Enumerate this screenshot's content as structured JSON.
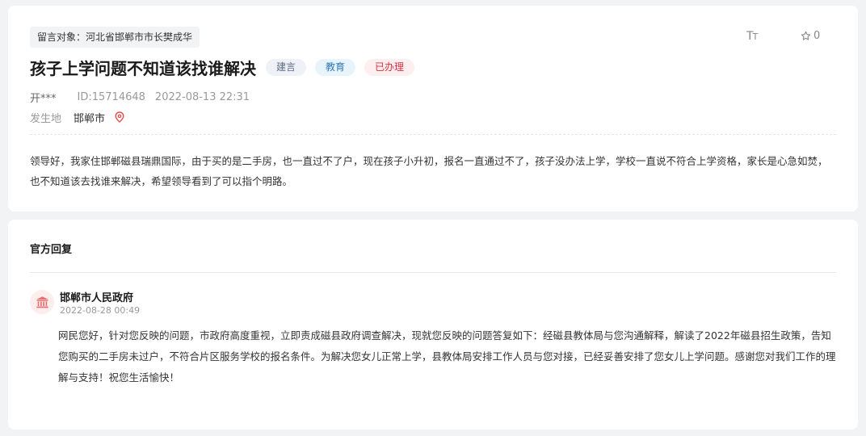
{
  "message": {
    "target": "留言对象：河北省邯郸市市长樊成华",
    "title": "孩子上学问题不知道该找谁解决",
    "tags": [
      "建言",
      "教育",
      "已办理"
    ],
    "user": "开***",
    "id": "ID:15714648",
    "datetime": "2022-08-13 22:31",
    "location_label": "发生地",
    "location": "邯郸市",
    "content": "领导好，我家住邯郸磁县瑞鼎国际，由于买的是二手房，也一直过不了户，现在孩子小升初，报名一直通过不了，孩子没办法上学，学校一直说不符合上学资格，家长是心急如焚，也不知道该去找谁来解决，希望领导看到了可以指个明路。"
  },
  "toolbar": {
    "font_icon": "font-size-icon",
    "star_icon": "star-outline-icon",
    "star_count": "0"
  },
  "reply": {
    "heading": "官方回复",
    "avatar_icon": "government-building-icon",
    "org": "邯郸市人民政府",
    "datetime": "2022-08-28 00:49",
    "content": "网民您好，针对您反映的问题，市政府高度重视，立即责成磁县政府调查解决，现就您反映的问题答复如下：经磁县教体局与您沟通解释，解读了2022年磁县招生政策，告知您购买的二手房未过户，不符合片区服务学校的报名条件。为解决您女儿正常上学，县教体局安排工作人员与您对接，已经妥善安排了您女儿上学问题。感谢您对我们工作的理解与支持！祝您生活愉快！"
  },
  "colors": {
    "tag_suggest": "#5d6b85",
    "tag_edu": "#2f78b8",
    "tag_done": "#d6303f",
    "location_pin": "#e5484d",
    "avatar_icon": "#e8706f"
  }
}
